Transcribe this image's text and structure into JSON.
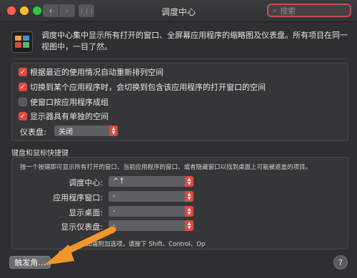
{
  "window": {
    "title": "调度中心",
    "back_icon": "‹",
    "forward_icon": "›",
    "grid_icon": "⋮⋮⋮",
    "search_placeholder": "搜索"
  },
  "description": "调度中心集中显示所有打开的窗口、全屏幕应用程序的缩略图及仪表盘。所有项目在同一视图中，一目了然。",
  "options": [
    {
      "label": "根据最近的使用情况自动重新排列空间",
      "checked": true
    },
    {
      "label": "切换到某个应用程序时，会切换到包含该应用程序的打开窗口的空间",
      "checked": true
    },
    {
      "label": "使窗口按应用程序成组",
      "checked": false
    },
    {
      "label": "显示器具有单独的空间",
      "checked": true
    }
  ],
  "dashboard": {
    "label": "仪表盘:",
    "value": "关闭"
  },
  "shortcuts": {
    "title": "键盘和鼠标快捷键",
    "hint": "按一个按键即可显示所有打开的窗口、当前应用程序的窗口、或者隐藏窗口以找到桌面上可能被遮盖的项目。",
    "rows": [
      {
        "label": "调度中心:",
        "value": "^↑"
      },
      {
        "label": "应用程序窗口:",
        "value": "-"
      },
      {
        "label": "显示桌面:",
        "value": "-"
      },
      {
        "label": "显示仪表盘:",
        "value": "-"
      }
    ],
    "note": "（如需附加选项，请按下 Shift、Control、Op"
  },
  "hot_corners_button": "触发角...",
  "help_button": "?",
  "colors": {
    "accent": "#e0483e",
    "arrow": "#f0962a",
    "background": "#2f2f31"
  }
}
